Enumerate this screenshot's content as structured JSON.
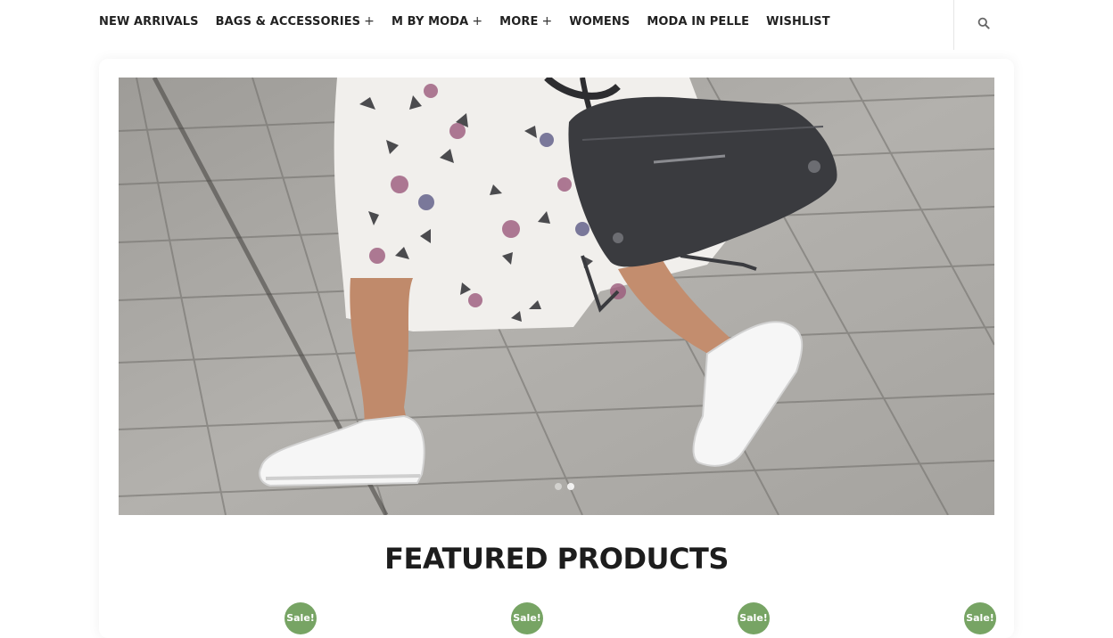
{
  "header": {
    "nav": [
      {
        "label": "NEW ARRIVALS",
        "has_submenu": false
      },
      {
        "label": "BAGS & ACCESSORIES",
        "has_submenu": true
      },
      {
        "label": "M BY MODA",
        "has_submenu": true
      },
      {
        "label": "MORE",
        "has_submenu": true
      },
      {
        "label": "WOMENS",
        "has_submenu": false
      },
      {
        "label": "MODA IN PELLE",
        "has_submenu": false
      },
      {
        "label": "WISHLIST",
        "has_submenu": false
      }
    ],
    "submenu_symbol": "+",
    "search_icon": "search-icon"
  },
  "hero": {
    "slides": 2,
    "active_slide": 1
  },
  "featured": {
    "title": "FEATURED PRODUCTS",
    "sale_badges": [
      "Sale!",
      "Sale!",
      "Sale!",
      "Sale!"
    ]
  },
  "colors": {
    "sale_badge": "#77a464",
    "nav_text": "#222222",
    "title_text": "#1d1d1d"
  }
}
